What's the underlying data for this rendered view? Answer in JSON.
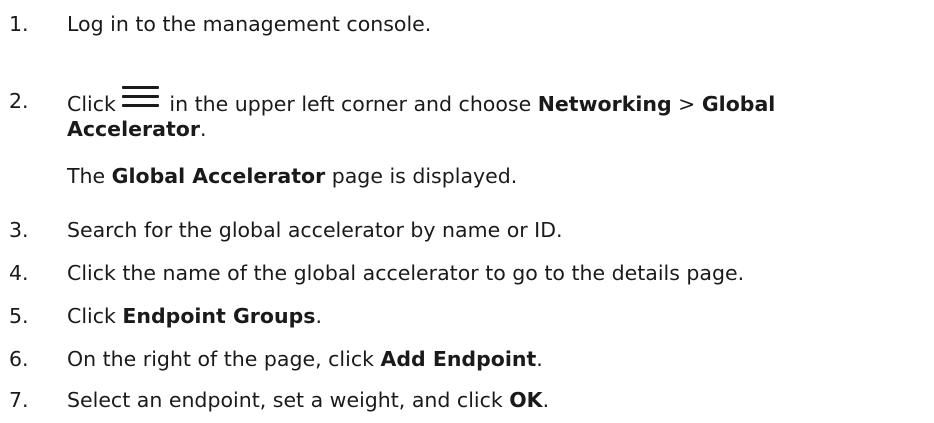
{
  "steps": [
    {
      "num": "1.",
      "text": "Log in to the management console."
    },
    {
      "num": "2.",
      "pre": "Click",
      "icon": "menu-icon",
      "mid": " in the upper left corner and choose ",
      "b1": "Networking",
      "sep": " > ",
      "b2a": "Global",
      "b2b": "Accelerator",
      "end": "."
    },
    {
      "note_pre": "The ",
      "note_b": "Global Accelerator",
      "note_post": " page is displayed."
    },
    {
      "num": "3.",
      "text": "Search for the global accelerator by name or ID."
    },
    {
      "num": "4.",
      "text": "Click the name of the global accelerator to go to the details page."
    },
    {
      "num": "5.",
      "pre": "Click ",
      "b": "Endpoint Groups",
      "post": "."
    },
    {
      "num": "6.",
      "pre": "On the right of the page, click ",
      "b": "Add Endpoint",
      "post": "."
    },
    {
      "num": "7.",
      "pre": "Select an endpoint, set a weight, and click ",
      "b": "OK",
      "post": "."
    }
  ]
}
